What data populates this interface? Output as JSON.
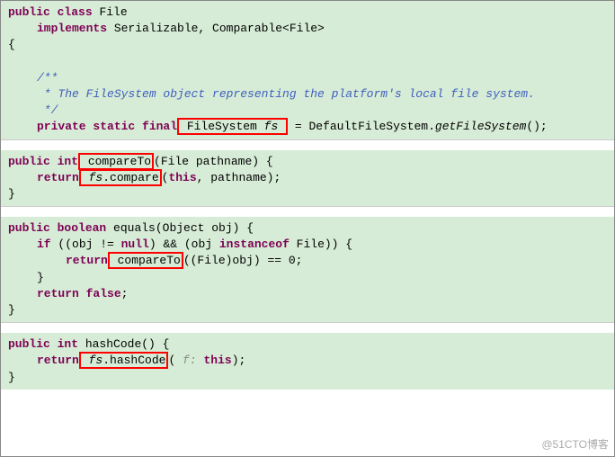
{
  "block1": {
    "l1_kw1": "public",
    "l1_kw2": "class",
    "l1_name": " File",
    "l2_kw": "implements",
    "l2_rest": " Serializable, Comparable<File>",
    "l3": "{",
    "c1": "/**",
    "c2": " * The FileSystem object representing the platform's local file system.",
    "c3": " */",
    "l4_kw": "private static final",
    "l4_box": " FileSystem ",
    "l4_box_italic": "fs",
    "l4_eq": " = DefaultFileSystem.",
    "l4_call": "getFileSystem",
    "l4_end": "();"
  },
  "block2": {
    "l1_kw1": "public",
    "l1_kw2": " int",
    "l1_box": " compareTo",
    "l1_rest": "(File pathname) {",
    "l2_kw": "return",
    "l2_box_italic": " fs",
    "l2_box_plain": ".compare",
    "l2_rest1": "(",
    "l2_kw2": "this",
    "l2_rest2": ", pathname);",
    "l3": "}"
  },
  "block3": {
    "l1_kw1": "public",
    "l1_kw2": " boolean",
    "l1_name": " equals(Object obj) {",
    "l2_kw1": "if",
    "l2_mid1": " ((obj != ",
    "l2_kw2": "null",
    "l2_mid2": ") && (obj ",
    "l2_kw3": "instanceof",
    "l2_mid3": " File)) {",
    "l3_kw": "return",
    "l3_box": " compareTo",
    "l3_rest": "((File)obj) == 0;",
    "l4": "}",
    "l5_kw": "return false",
    "l5_end": ";",
    "l6": "}"
  },
  "block4": {
    "l1_kw1": "public",
    "l1_kw2": " int",
    "l1_name": " hashCode() {",
    "l2_kw": "return",
    "l2_box_italic": " fs",
    "l2_box_plain": ".hashCode",
    "l2_rest1": "(",
    "l2_hint": " f: ",
    "l2_kw2": "this",
    "l2_rest2": ");",
    "l3": "}"
  },
  "watermark": "@51CTO博客"
}
